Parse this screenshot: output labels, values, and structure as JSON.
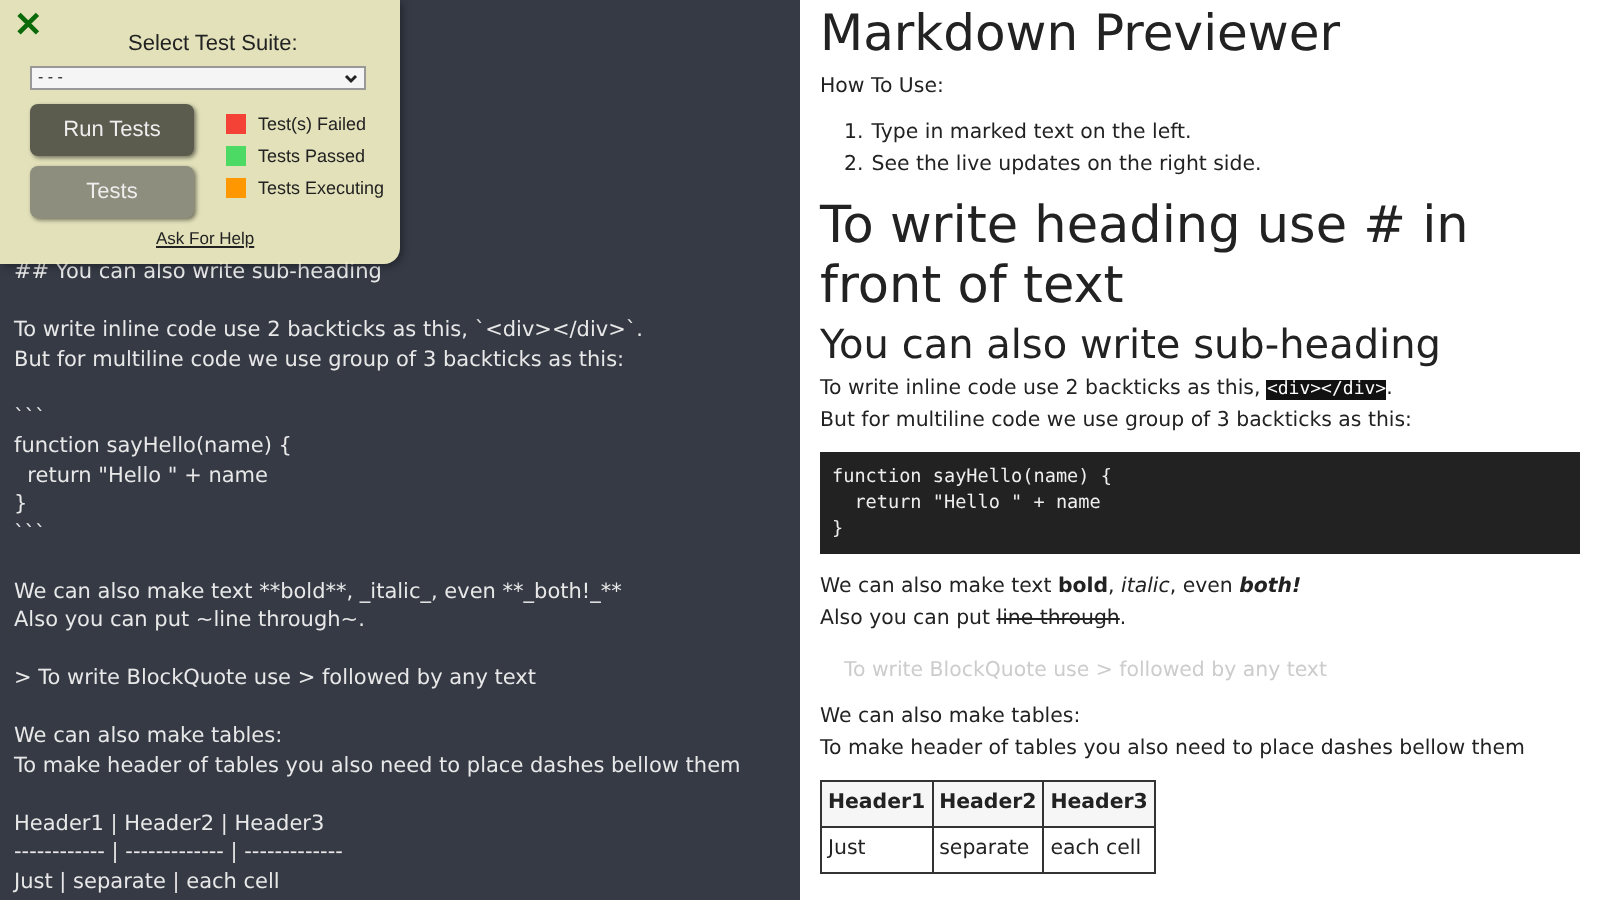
{
  "editor": {
    "paragraphs": [
      [
        "## You can also write sub-heading"
      ],
      [
        "To write inline code use 2 backticks as this, `<div></div>`.",
        "But for multiline code we use group of 3 backticks as this:"
      ],
      [
        "```",
        "function sayHello(name) {",
        "  return \"Hello \" + name",
        "}",
        "```"
      ],
      [
        "We can also make text **bold**, _italic_, even **_both!_**",
        "Also you can put ~line through~."
      ],
      [
        "> To write BlockQuote use > followed by any text"
      ],
      [
        "We can also make tables:",
        "To make header of tables you also need to place dashes bellow them"
      ],
      [
        "Header1 | Header2 | Header3",
        "------------ | ------------- | -------------",
        "Just | separate | each cell"
      ]
    ]
  },
  "test_panel": {
    "close": "✕",
    "select_label": "Select Test Suite:",
    "select_value": "- - -",
    "buttons": [
      {
        "label": "Run Tests",
        "disabled": false
      },
      {
        "label": "Tests",
        "disabled": true
      }
    ],
    "legend": [
      {
        "label": "Test(s) Failed",
        "color": "#f44336"
      },
      {
        "label": "Tests Passed",
        "color": "#4cd964"
      },
      {
        "label": "Tests Executing",
        "color": "#ff9800"
      }
    ],
    "help_link": "Ask For Help"
  },
  "preview": {
    "blocks": [
      {
        "kind": "h1",
        "text": "Markdown Previewer"
      },
      {
        "kind": "p",
        "lines": [
          [
            {
              "kind": "plain",
              "text": "How To Use:"
            }
          ]
        ]
      },
      {
        "kind": "ol",
        "items": [
          {
            "marker": "1.",
            "text": "Type in marked text on the left."
          },
          {
            "marker": "2.",
            "text": "See the live updates on the right side."
          }
        ]
      },
      {
        "kind": "h1",
        "text": "To write heading use # in front of text"
      },
      {
        "kind": "h2",
        "text": "You can also write sub-heading"
      },
      {
        "kind": "p",
        "lines": [
          [
            {
              "kind": "plain",
              "text": "To write inline code use 2 backticks as this, "
            },
            {
              "kind": "code",
              "text": "<div></div>"
            },
            {
              "kind": "plain",
              "text": "."
            }
          ],
          [
            {
              "kind": "plain",
              "text": "But for multiline code we use group of 3 backticks as this:"
            }
          ]
        ]
      },
      {
        "kind": "pre",
        "lines": [
          "function sayHello(name) {",
          "  return \"Hello \" + name",
          "}"
        ]
      },
      {
        "kind": "p",
        "lines": [
          [
            {
              "kind": "plain",
              "text": "We can also make text "
            },
            {
              "kind": "bold",
              "text": "bold"
            },
            {
              "kind": "plain",
              "text": ", "
            },
            {
              "kind": "italic",
              "text": "italic"
            },
            {
              "kind": "plain",
              "text": ", even "
            },
            {
              "kind": "bolditalic",
              "text": "both!"
            }
          ],
          [
            {
              "kind": "plain",
              "text": "Also you can put "
            },
            {
              "kind": "strike",
              "text": "line through"
            },
            {
              "kind": "plain",
              "text": "."
            }
          ]
        ]
      },
      {
        "kind": "blockquote",
        "text": "To write BlockQuote use > followed by any text"
      },
      {
        "kind": "p",
        "lines": [
          [
            {
              "kind": "plain",
              "text": "We can also make tables:"
            }
          ],
          [
            {
              "kind": "plain",
              "text": "To make header of tables you also need to place dashes bellow them"
            }
          ]
        ]
      },
      {
        "kind": "table",
        "columns": [
          "Header1",
          "Header2",
          "Header3"
        ],
        "rows": [
          [
            "Just",
            "separate",
            "each cell"
          ]
        ]
      }
    ]
  }
}
